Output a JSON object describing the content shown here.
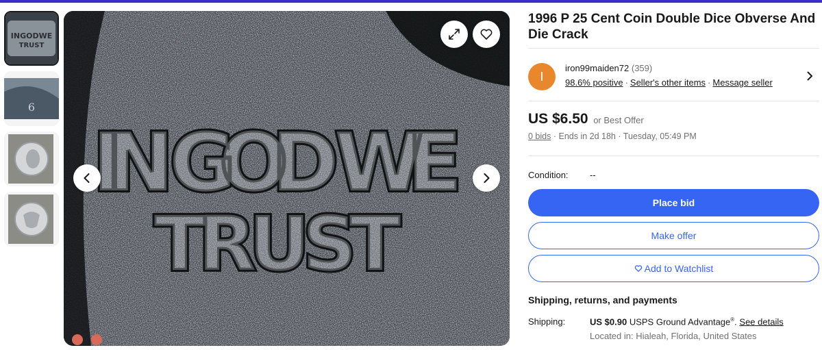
{
  "listing": {
    "title": "1996 P 25 Cent Coin Double Dice Obverse And Die Crack",
    "image_text_line1": "IN GOD WE",
    "image_text_line2": "TRUST"
  },
  "seller": {
    "avatar_letter": "I",
    "name": "iron99maiden72",
    "feedback_count": "(359)",
    "positive": "98.6% positive",
    "other_items": "Seller's other items",
    "message": "Message seller"
  },
  "pricing": {
    "price": "US $6.50",
    "best_offer": "or Best Offer",
    "bids": "0 bids",
    "ends": "Ends in 2d 18h",
    "end_time": "Tuesday, 05:49 PM"
  },
  "condition": {
    "label": "Condition:",
    "value": "--"
  },
  "actions": {
    "place_bid": "Place bid",
    "make_offer": "Make offer",
    "watchlist": "Add to Watchlist"
  },
  "shipping": {
    "heading": "Shipping, returns, and payments",
    "label": "Shipping:",
    "cost": "US $0.90",
    "service": "USPS Ground Advantage",
    "registered": "®",
    "see_details": "See details",
    "location": "Located in: Hialeah, Florida, United States"
  },
  "colors": {
    "accent": "#3665f3",
    "avatar": "#e8872b",
    "top_bar": "#3b2fc9"
  }
}
